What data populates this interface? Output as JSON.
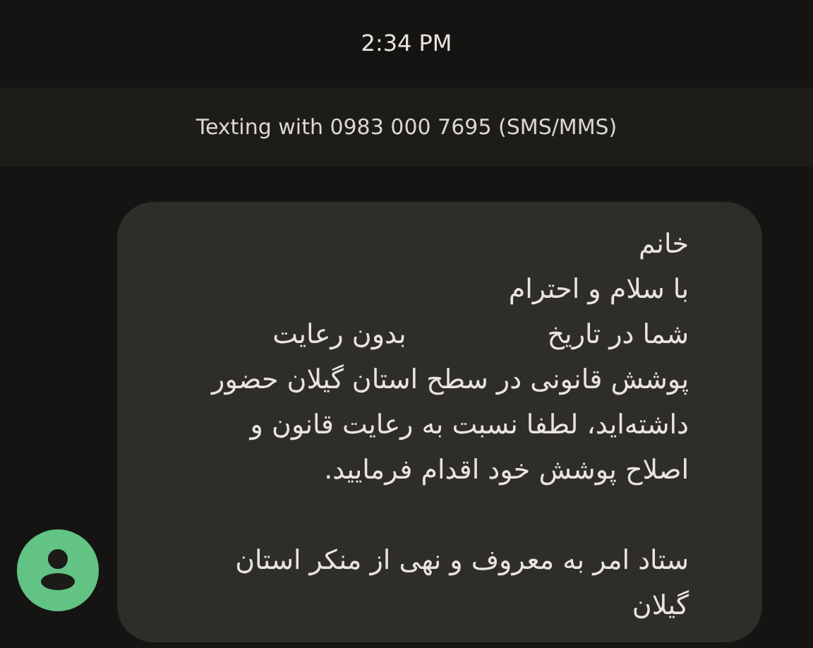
{
  "status_bar": {
    "time": "2:34 PM"
  },
  "header": {
    "title": "Texting with 0983 000 7695 (SMS/MMS)"
  },
  "message": {
    "paragraphs": [
      {
        "lines": [
          {
            "segments": [
              "خانم"
            ]
          },
          {
            "segments": [
              "با سلام و احترام"
            ]
          },
          {
            "segments": [
              "شما در تاریخ",
              "بدون رعایت"
            ]
          },
          {
            "segments": [
              "پوشش قانونی در سطح استان گیلان حضور"
            ]
          },
          {
            "segments": [
              "داشته‌اید، لطفا نسبت به رعایت قانون و"
            ]
          },
          {
            "segments": [
              "اصلاح پوشش خود اقدام فرمایید."
            ]
          }
        ]
      },
      {
        "lines": [
          {
            "segments": [
              "ستاد امر به معروف و نهی از منکر استان"
            ]
          },
          {
            "segments": [
              "گیلان"
            ]
          }
        ]
      }
    ]
  }
}
